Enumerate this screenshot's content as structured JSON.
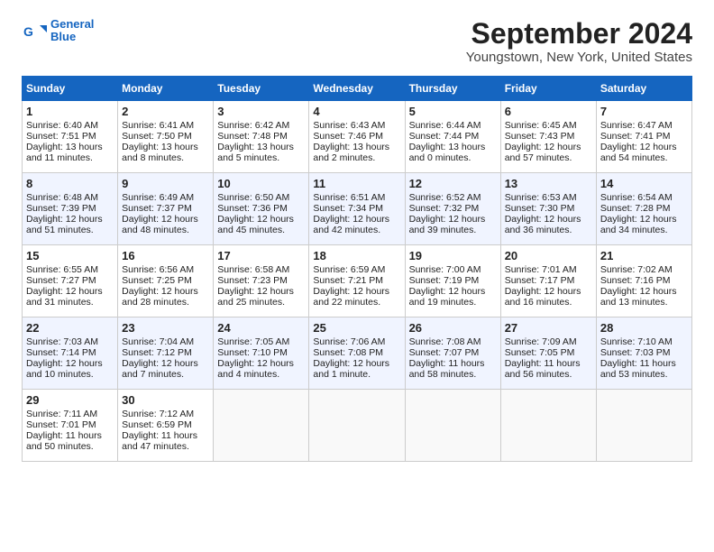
{
  "header": {
    "logo_line1": "General",
    "logo_line2": "Blue",
    "title": "September 2024",
    "subtitle": "Youngstown, New York, United States"
  },
  "columns": [
    "Sunday",
    "Monday",
    "Tuesday",
    "Wednesday",
    "Thursday",
    "Friday",
    "Saturday"
  ],
  "weeks": [
    [
      {
        "day": "1",
        "lines": [
          "Sunrise: 6:40 AM",
          "Sunset: 7:51 PM",
          "Daylight: 13 hours",
          "and 11 minutes."
        ]
      },
      {
        "day": "2",
        "lines": [
          "Sunrise: 6:41 AM",
          "Sunset: 7:50 PM",
          "Daylight: 13 hours",
          "and 8 minutes."
        ]
      },
      {
        "day": "3",
        "lines": [
          "Sunrise: 6:42 AM",
          "Sunset: 7:48 PM",
          "Daylight: 13 hours",
          "and 5 minutes."
        ]
      },
      {
        "day": "4",
        "lines": [
          "Sunrise: 6:43 AM",
          "Sunset: 7:46 PM",
          "Daylight: 13 hours",
          "and 2 minutes."
        ]
      },
      {
        "day": "5",
        "lines": [
          "Sunrise: 6:44 AM",
          "Sunset: 7:44 PM",
          "Daylight: 13 hours",
          "and 0 minutes."
        ]
      },
      {
        "day": "6",
        "lines": [
          "Sunrise: 6:45 AM",
          "Sunset: 7:43 PM",
          "Daylight: 12 hours",
          "and 57 minutes."
        ]
      },
      {
        "day": "7",
        "lines": [
          "Sunrise: 6:47 AM",
          "Sunset: 7:41 PM",
          "Daylight: 12 hours",
          "and 54 minutes."
        ]
      }
    ],
    [
      {
        "day": "8",
        "lines": [
          "Sunrise: 6:48 AM",
          "Sunset: 7:39 PM",
          "Daylight: 12 hours",
          "and 51 minutes."
        ]
      },
      {
        "day": "9",
        "lines": [
          "Sunrise: 6:49 AM",
          "Sunset: 7:37 PM",
          "Daylight: 12 hours",
          "and 48 minutes."
        ]
      },
      {
        "day": "10",
        "lines": [
          "Sunrise: 6:50 AM",
          "Sunset: 7:36 PM",
          "Daylight: 12 hours",
          "and 45 minutes."
        ]
      },
      {
        "day": "11",
        "lines": [
          "Sunrise: 6:51 AM",
          "Sunset: 7:34 PM",
          "Daylight: 12 hours",
          "and 42 minutes."
        ]
      },
      {
        "day": "12",
        "lines": [
          "Sunrise: 6:52 AM",
          "Sunset: 7:32 PM",
          "Daylight: 12 hours",
          "and 39 minutes."
        ]
      },
      {
        "day": "13",
        "lines": [
          "Sunrise: 6:53 AM",
          "Sunset: 7:30 PM",
          "Daylight: 12 hours",
          "and 36 minutes."
        ]
      },
      {
        "day": "14",
        "lines": [
          "Sunrise: 6:54 AM",
          "Sunset: 7:28 PM",
          "Daylight: 12 hours",
          "and 34 minutes."
        ]
      }
    ],
    [
      {
        "day": "15",
        "lines": [
          "Sunrise: 6:55 AM",
          "Sunset: 7:27 PM",
          "Daylight: 12 hours",
          "and 31 minutes."
        ]
      },
      {
        "day": "16",
        "lines": [
          "Sunrise: 6:56 AM",
          "Sunset: 7:25 PM",
          "Daylight: 12 hours",
          "and 28 minutes."
        ]
      },
      {
        "day": "17",
        "lines": [
          "Sunrise: 6:58 AM",
          "Sunset: 7:23 PM",
          "Daylight: 12 hours",
          "and 25 minutes."
        ]
      },
      {
        "day": "18",
        "lines": [
          "Sunrise: 6:59 AM",
          "Sunset: 7:21 PM",
          "Daylight: 12 hours",
          "and 22 minutes."
        ]
      },
      {
        "day": "19",
        "lines": [
          "Sunrise: 7:00 AM",
          "Sunset: 7:19 PM",
          "Daylight: 12 hours",
          "and 19 minutes."
        ]
      },
      {
        "day": "20",
        "lines": [
          "Sunrise: 7:01 AM",
          "Sunset: 7:17 PM",
          "Daylight: 12 hours",
          "and 16 minutes."
        ]
      },
      {
        "day": "21",
        "lines": [
          "Sunrise: 7:02 AM",
          "Sunset: 7:16 PM",
          "Daylight: 12 hours",
          "and 13 minutes."
        ]
      }
    ],
    [
      {
        "day": "22",
        "lines": [
          "Sunrise: 7:03 AM",
          "Sunset: 7:14 PM",
          "Daylight: 12 hours",
          "and 10 minutes."
        ]
      },
      {
        "day": "23",
        "lines": [
          "Sunrise: 7:04 AM",
          "Sunset: 7:12 PM",
          "Daylight: 12 hours",
          "and 7 minutes."
        ]
      },
      {
        "day": "24",
        "lines": [
          "Sunrise: 7:05 AM",
          "Sunset: 7:10 PM",
          "Daylight: 12 hours",
          "and 4 minutes."
        ]
      },
      {
        "day": "25",
        "lines": [
          "Sunrise: 7:06 AM",
          "Sunset: 7:08 PM",
          "Daylight: 12 hours",
          "and 1 minute."
        ]
      },
      {
        "day": "26",
        "lines": [
          "Sunrise: 7:08 AM",
          "Sunset: 7:07 PM",
          "Daylight: 11 hours",
          "and 58 minutes."
        ]
      },
      {
        "day": "27",
        "lines": [
          "Sunrise: 7:09 AM",
          "Sunset: 7:05 PM",
          "Daylight: 11 hours",
          "and 56 minutes."
        ]
      },
      {
        "day": "28",
        "lines": [
          "Sunrise: 7:10 AM",
          "Sunset: 7:03 PM",
          "Daylight: 11 hours",
          "and 53 minutes."
        ]
      }
    ],
    [
      {
        "day": "29",
        "lines": [
          "Sunrise: 7:11 AM",
          "Sunset: 7:01 PM",
          "Daylight: 11 hours",
          "and 50 minutes."
        ]
      },
      {
        "day": "30",
        "lines": [
          "Sunrise: 7:12 AM",
          "Sunset: 6:59 PM",
          "Daylight: 11 hours",
          "and 47 minutes."
        ]
      },
      {
        "day": "",
        "lines": []
      },
      {
        "day": "",
        "lines": []
      },
      {
        "day": "",
        "lines": []
      },
      {
        "day": "",
        "lines": []
      },
      {
        "day": "",
        "lines": []
      }
    ]
  ]
}
